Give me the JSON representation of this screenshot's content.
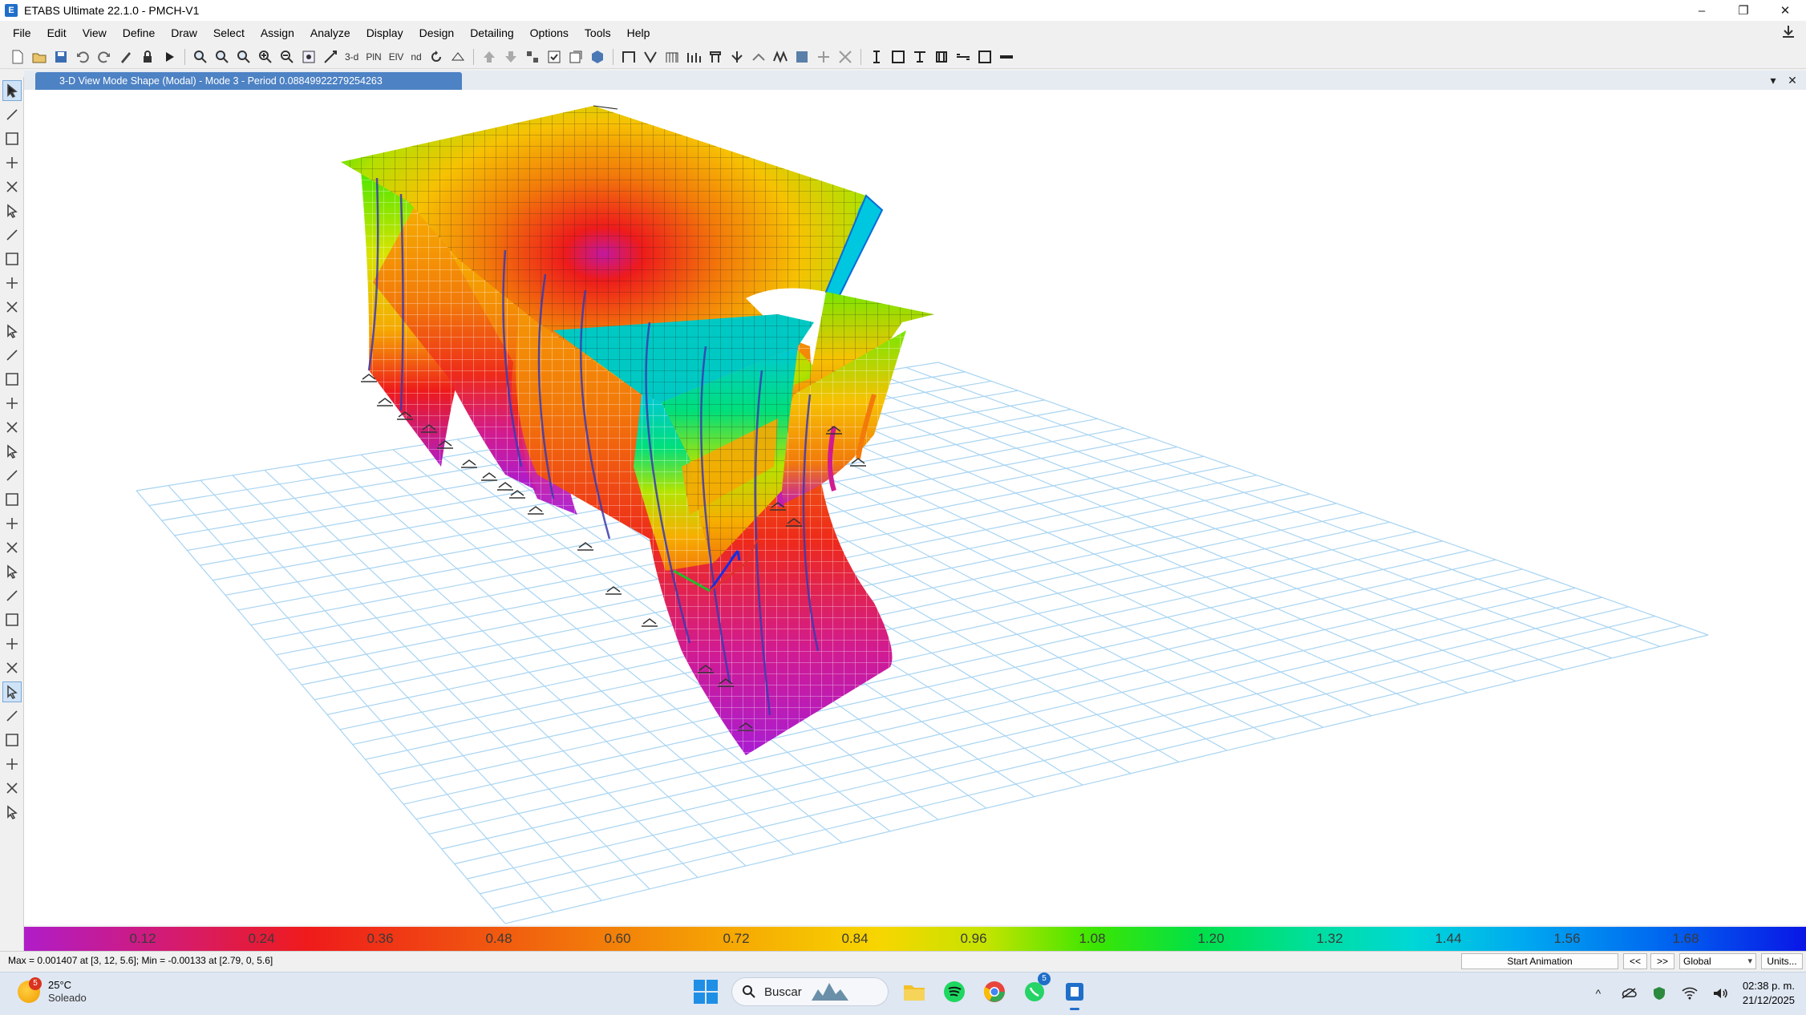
{
  "window": {
    "title": "ETABS Ultimate 22.1.0 - PMCH-V1",
    "logo_letter": "E",
    "minimize": "–",
    "restore": "❐",
    "close": "✕"
  },
  "menu": [
    "File",
    "Edit",
    "View",
    "Define",
    "Draw",
    "Select",
    "Assign",
    "Analyze",
    "Display",
    "Design",
    "Detailing",
    "Options",
    "Tools",
    "Help"
  ],
  "toolbar": {
    "view_3d_label": "3-d",
    "plan_label": "PlN",
    "elev_label": "ElV",
    "nd_label": "nd"
  },
  "document": {
    "tab_title": "3-D View  Mode Shape (Modal) - Mode 3 - Period 0.08849922279254263",
    "dropdown": "▾",
    "close": "✕"
  },
  "legend": {
    "ticks": [
      "0.12",
      "0.24",
      "0.36",
      "0.48",
      "0.60",
      "0.72",
      "0.84",
      "0.96",
      "1.08",
      "1.20",
      "1.32",
      "1.44",
      "1.56",
      "1.68"
    ],
    "colors": [
      "#b01cc8",
      "#ef1b1b",
      "#f6a903",
      "#f7d600",
      "#3ce600",
      "#00d7d7",
      "#00aaf0",
      "#0a16e6"
    ]
  },
  "status": {
    "text": "Max = 0.001407 at [3, 12, 5.6];  Min = -0.00133 at [2.79, 0, 5.6]",
    "start_animation": "Start Animation",
    "prev": "<<",
    "next": ">>",
    "coord_system": "Global",
    "units": "Units..."
  },
  "taskbar": {
    "weather_temp": "25°C",
    "weather_desc": "Soleado",
    "weather_badge": "5",
    "search_placeholder": "Buscar",
    "whatsapp_badge": "5",
    "time": "02:38 p. m.",
    "date": "21/12/2025"
  }
}
